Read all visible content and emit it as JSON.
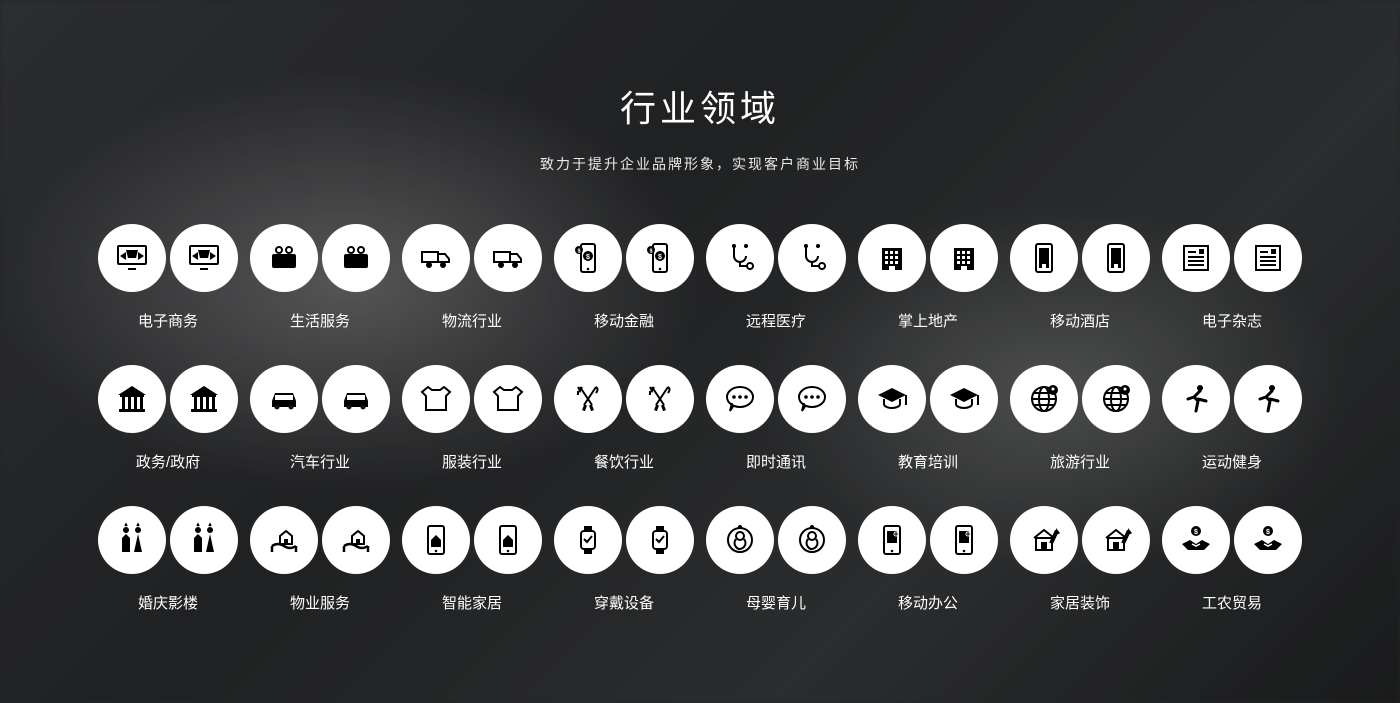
{
  "heading": "行业领域",
  "subheading": "致力于提升企业品牌形象，实现客户商业目标",
  "rows": [
    [
      {
        "label": "电子商务",
        "icon": "ecommerce"
      },
      {
        "label": "生活服务",
        "icon": "life"
      },
      {
        "label": "物流行业",
        "icon": "logistics"
      },
      {
        "label": "移动金融",
        "icon": "finance"
      },
      {
        "label": "远程医疗",
        "icon": "medical"
      },
      {
        "label": "掌上地产",
        "icon": "realestate"
      },
      {
        "label": "移动酒店",
        "icon": "hotel"
      },
      {
        "label": "电子杂志",
        "icon": "magazine"
      }
    ],
    [
      {
        "label": "政务/政府",
        "icon": "gov"
      },
      {
        "label": "汽车行业",
        "icon": "car"
      },
      {
        "label": "服装行业",
        "icon": "shirt"
      },
      {
        "label": "餐饮行业",
        "icon": "food"
      },
      {
        "label": "即时通讯",
        "icon": "chat"
      },
      {
        "label": "教育培训",
        "icon": "edu"
      },
      {
        "label": "旅游行业",
        "icon": "travel"
      },
      {
        "label": "运动健身",
        "icon": "run"
      }
    ],
    [
      {
        "label": "婚庆影楼",
        "icon": "wedding"
      },
      {
        "label": "物业服务",
        "icon": "property"
      },
      {
        "label": "智能家居",
        "icon": "smarthome"
      },
      {
        "label": "穿戴设备",
        "icon": "watch"
      },
      {
        "label": "母婴育儿",
        "icon": "baby"
      },
      {
        "label": "移动办公",
        "icon": "office"
      },
      {
        "label": "家居装饰",
        "icon": "decor"
      },
      {
        "label": "工农贸易",
        "icon": "trade"
      }
    ]
  ]
}
